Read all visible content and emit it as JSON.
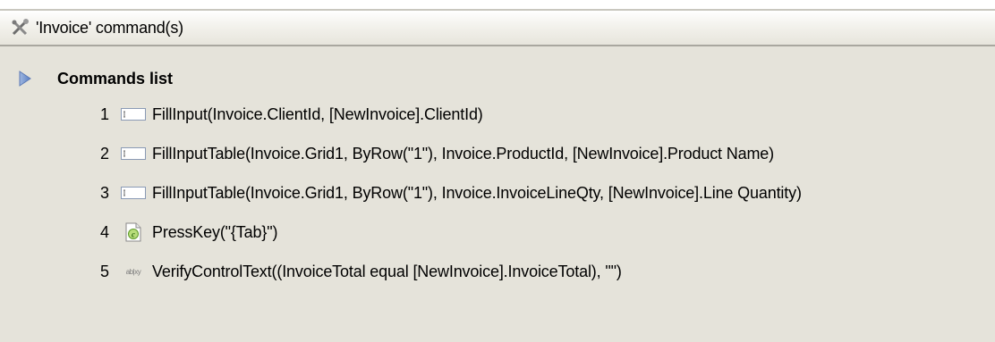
{
  "header": {
    "icon": "tools-icon",
    "title": "'Invoice' command(s)"
  },
  "section": {
    "toggle_icon": "triangle-right-icon",
    "title": "Commands list"
  },
  "commands": [
    {
      "num": "1",
      "icon": "input-field-icon",
      "text": "FillInput(Invoice.ClientId, [NewInvoice].ClientId)"
    },
    {
      "num": "2",
      "icon": "input-field-icon",
      "text": "FillInputTable(Invoice.Grid1, ByRow(\"1\"), Invoice.ProductId, [NewInvoice].Product Name)"
    },
    {
      "num": "3",
      "icon": "input-field-icon",
      "text": "FillInputTable(Invoice.Grid1, ByRow(\"1\"), Invoice.InvoiceLineQty, [NewInvoice].Line Quantity)"
    },
    {
      "num": "4",
      "icon": "key-script-icon",
      "text": "PressKey(\"{Tab}\")"
    },
    {
      "num": "5",
      "icon": "text-verify-icon",
      "icon_text": "ab|xy",
      "text": "VerifyControlText((InvoiceTotal equal [NewInvoice].InvoiceTotal), \"\")"
    }
  ]
}
